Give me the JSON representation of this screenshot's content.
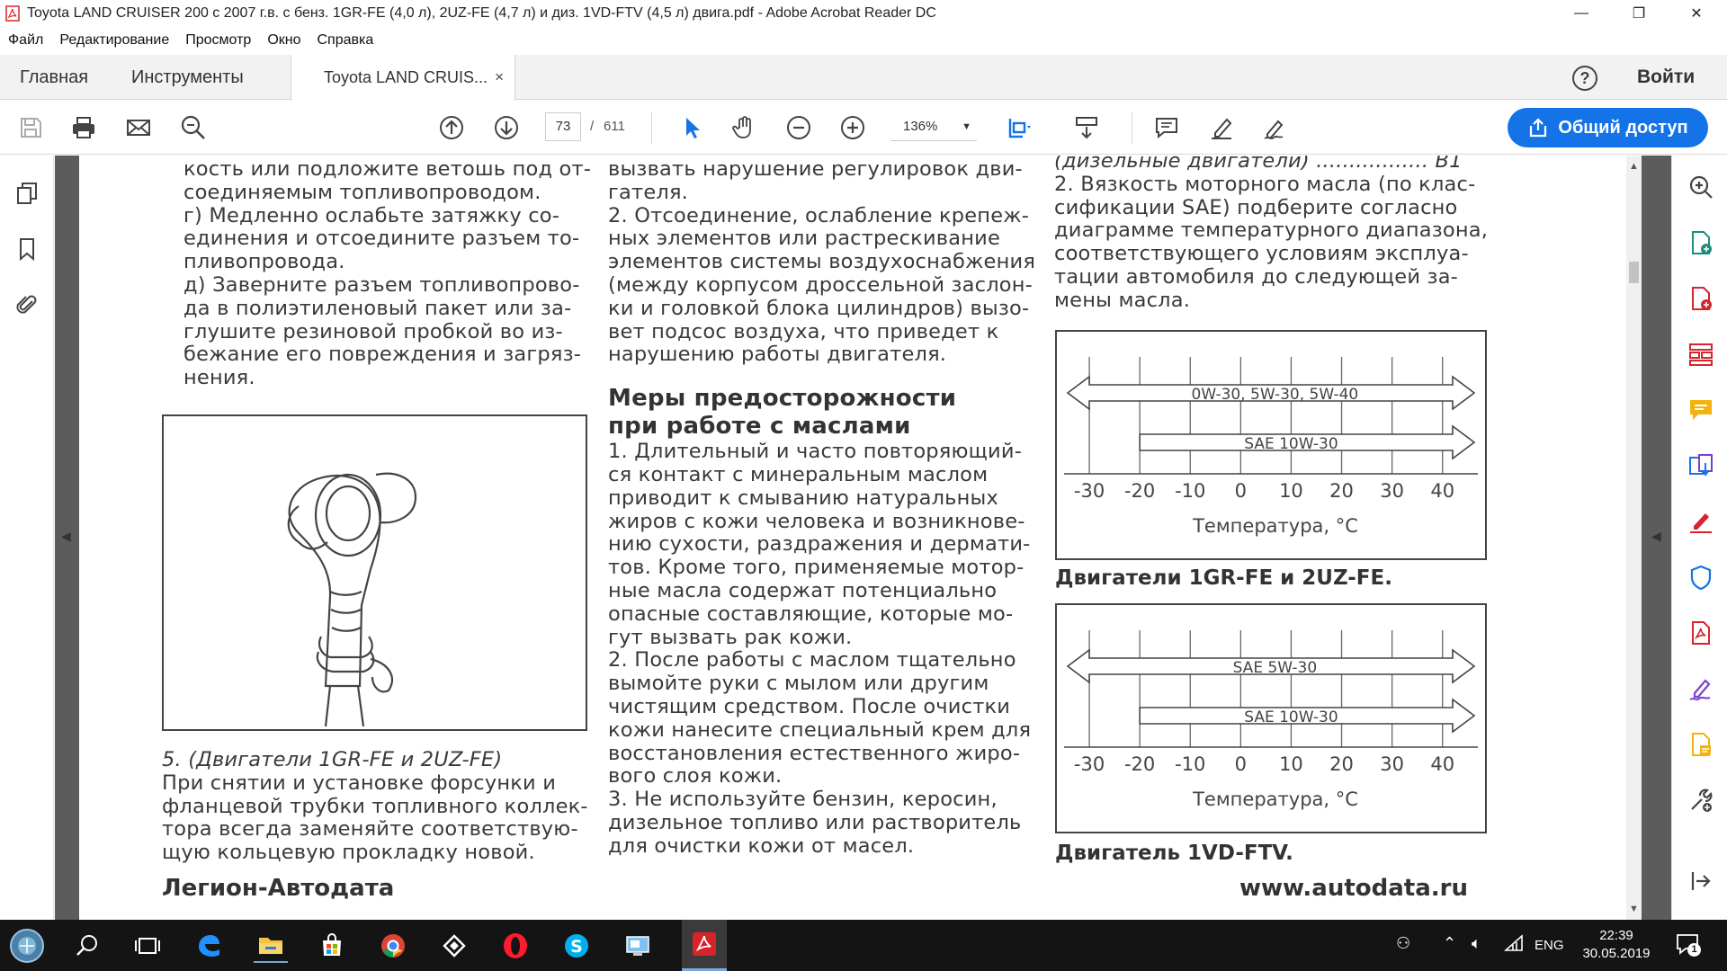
{
  "window": {
    "title": "Toyota LAND CRUISER 200 с 2007 г.в. с бенз. 1GR-FE (4,0 л), 2UZ-FE (4,7 л) и диз. 1VD-FTV (4,5 л) двига.pdf - Adobe Acrobat Reader DC",
    "minimize": "—",
    "maximize": "❐",
    "close": "✕"
  },
  "menu": [
    "Файл",
    "Редактирование",
    "Просмотр",
    "Окно",
    "Справка"
  ],
  "tabs": {
    "home": "Главная",
    "tools": "Инструменты",
    "document": "Toyota LAND CRUIS...",
    "document_close": "×",
    "help": "?",
    "login": "Войти"
  },
  "toolbar": {
    "page_current": "73",
    "page_separator": "/",
    "page_total": "611",
    "zoom": "136%",
    "share_label": "Общий доступ"
  },
  "document": {
    "col1": [
      "кость или подложите ветошь под от-",
      "соединяемым топливопроводом.",
      "г) Медленно ослабьте затяжку со-",
      "единения и отсоедините разъем то-",
      "пливопровода.",
      "д) Заверните разъем топливопрово-",
      "да в полиэтиленовый пакет или за-",
      "глушите резиновой пробкой во из-",
      "бежание его повреждения и загряз-",
      "нения."
    ],
    "col1_caption": "5. (Двигатели 1GR-FE и 2UZ-FE)",
    "col1_after": [
      "При снятии и установке форсунки и",
      "фланцевой трубки топливного коллек-",
      "тора всегда заменяйте соответствую-",
      "щую кольцевую прокладку новой."
    ],
    "footer_left": "Легион-Автодата",
    "col2_top": [
      "вызвать нарушение регулировок дви-",
      "гателя.",
      "2. Отсоединение, ослабление крепеж-",
      "ных элементов или растрескивание",
      "элементов системы воздухоснабжения",
      "(между корпусом дроссельной заслон-",
      "ки и головкой блока цилиндров) вызо-",
      "вет подсос воздуха, что приведет к",
      "нарушению работы двигателя."
    ],
    "col2_heading": [
      "Меры предосторожности",
      "при работе с маслами"
    ],
    "col2_body": [
      "1. Длительный и часто повторяющий-",
      "ся контакт с минеральным маслом",
      "приводит к смыванию натуральных",
      "жиров с кожи человека и возникнове-",
      "нию сухости, раздражения и дермати-",
      "тов. Кроме того, применяемые мотор-",
      "ные масла содержат потенциально",
      "опасные составляющие, которые мо-",
      "гут вызвать рак кожи.",
      "2. После работы с маслом тщательно",
      "вымойте руки с мылом или другим",
      "чистящим средством. После очистки",
      "кожи нанесите специальный крем для",
      "восстановления естественного жиро-",
      "вого слоя кожи.",
      "3. Не используйте бензин, керосин,",
      "дизельное топливо или растворитель",
      "для очистки кожи от масел."
    ],
    "col3_top_partial": "(дизельные двигатели) ................. В1",
    "col3_top": [
      "2. Вязкость моторного масла (по клас-",
      "сификации SAE) подберите согласно",
      "диаграмме температурного диапазона,",
      "соответствующего условиям эксплуа-",
      "тации автомобиля до следующей за-",
      "мены масла."
    ],
    "chart1_caption": "Двигатели 1GR-FE и 2UZ-FE.",
    "chart2_caption": "Двигатель 1VD-FTV.",
    "footer_right": "www.autodata.ru"
  },
  "chart_data": [
    {
      "type": "bar",
      "orientation": "horizontal-range",
      "categories": [
        "0W-30, 5W-30, 5W-40",
        "SAE 10W-30"
      ],
      "ranges": [
        [
          -30,
          40
        ],
        [
          -20,
          40
        ]
      ],
      "ticks": [
        -30,
        -20,
        -10,
        0,
        10,
        20,
        30,
        40
      ],
      "xlabel": "Температура, °С",
      "title": "Двигатели 1GR-FE и 2UZ-FE."
    },
    {
      "type": "bar",
      "orientation": "horizontal-range",
      "categories": [
        "SAE 5W-30",
        "SAE 10W-30"
      ],
      "ranges": [
        [
          -30,
          40
        ],
        [
          -20,
          40
        ]
      ],
      "ticks": [
        -30,
        -20,
        -10,
        0,
        10,
        20,
        30,
        40
      ],
      "xlabel": "Температура, °С",
      "title": "Двигатель 1VD-FTV."
    }
  ],
  "taskbar": {
    "lang": "ENG",
    "time": "22:39",
    "date": "30.05.2019",
    "notifications": "1"
  },
  "colors": {
    "accent": "#1473e6",
    "acrobat_red": "#d7242c"
  }
}
